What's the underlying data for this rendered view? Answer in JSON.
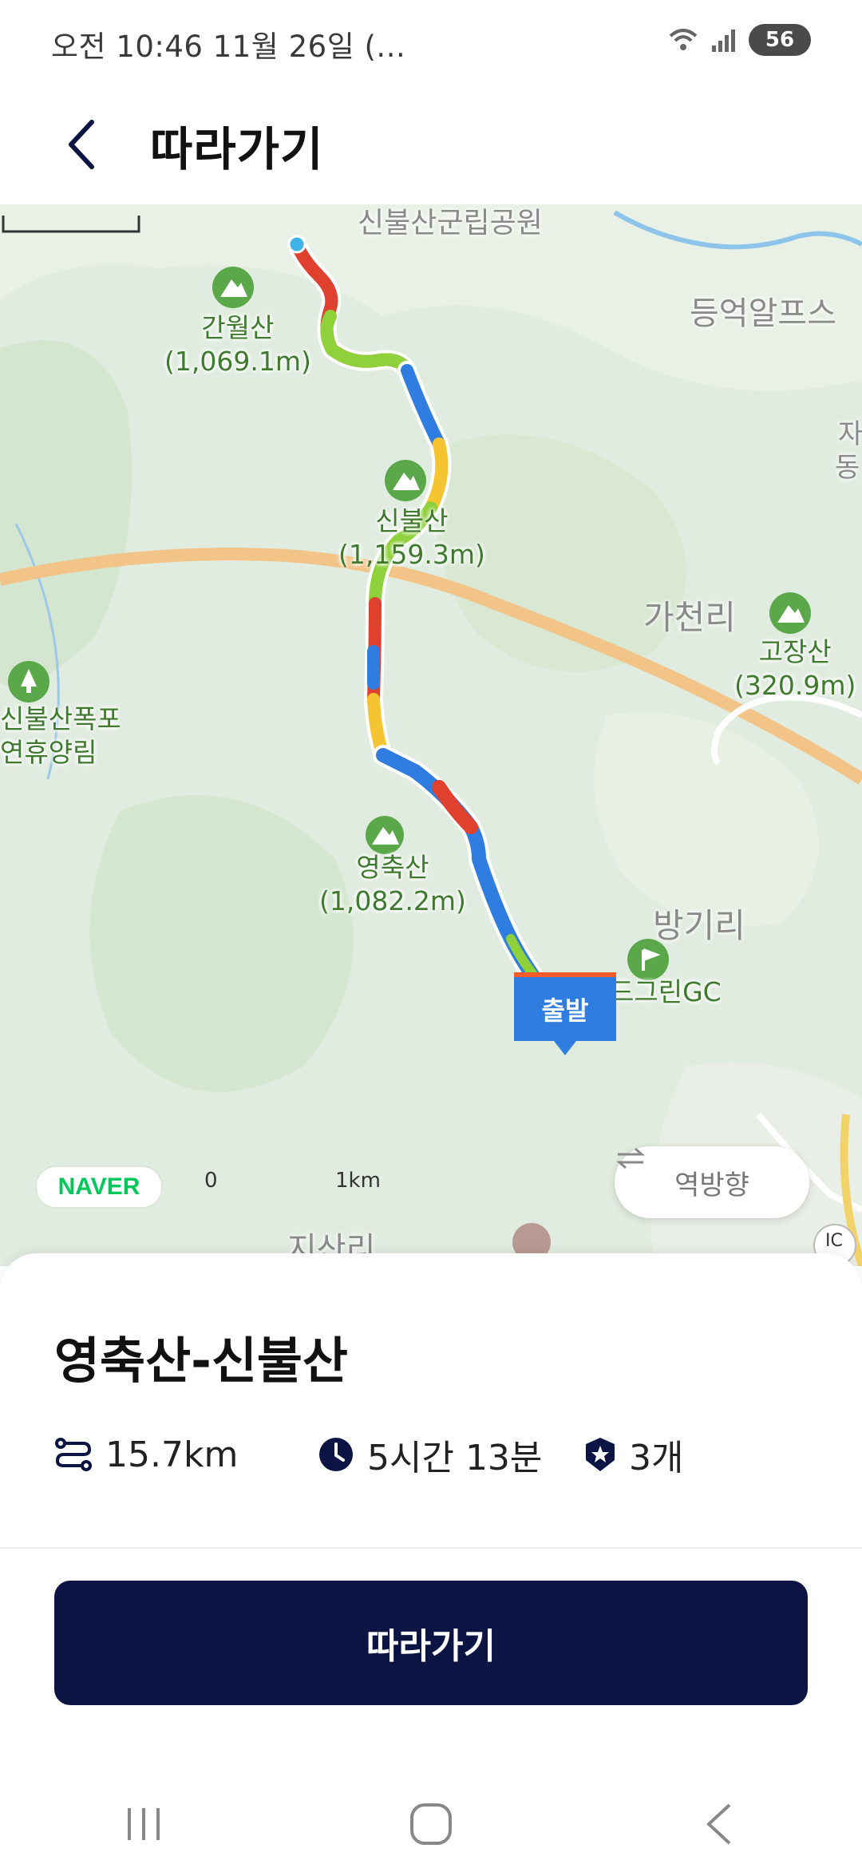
{
  "status": {
    "time": "오전 10:46  11월 26일 (...",
    "battery": "56"
  },
  "header": {
    "title": "따라가기"
  },
  "map": {
    "labels": {
      "park": "신불산군립공원",
      "alps": "등억알프스",
      "gacheonri": "가천리",
      "banggiri": "방기리",
      "jisanri": "지산리",
      "forest_line1": "신불산폭포",
      "forest_line2": "연휴양림",
      "golf": "드그린GC",
      "right_cut1": "자",
      "right_cut2": "동",
      "ic": "IC"
    },
    "peaks": [
      {
        "name": "간월산",
        "elevation": "(1,069.1m)"
      },
      {
        "name": "신불산",
        "elevation": "(1,159.3m)"
      },
      {
        "name": "영축산",
        "elevation": "(1,082.2m)"
      },
      {
        "name": "고장산",
        "elevation": "(320.9m)"
      }
    ],
    "brand": "NAVER",
    "scale_start": "0",
    "scale_end": "1km",
    "start_marker": "출발",
    "reverse_button": "역방향"
  },
  "course": {
    "title": "영축산-신불산",
    "distance": "15.7km",
    "duration": "5시간 13분",
    "badge_count": "3개"
  },
  "action": {
    "follow_label": "따라가기"
  },
  "icons": [
    "back-icon",
    "wifi-icon",
    "signal-icon",
    "battery-icon",
    "distance-icon",
    "clock-icon",
    "badge-icon",
    "reverse-icon",
    "mountain-icon",
    "tree-icon",
    "golf-icon",
    "recent-apps-icon",
    "home-icon",
    "nav-back-icon"
  ],
  "colors": {
    "primary_button": "#0b1442",
    "route_blue": "#2f7de1",
    "route_red": "#e0402e",
    "route_green": "#8fd13a",
    "route_yellow": "#f5c531",
    "road": "#f2c488",
    "peak_green": "#5aa84a",
    "brand_green": "#03c75a"
  }
}
